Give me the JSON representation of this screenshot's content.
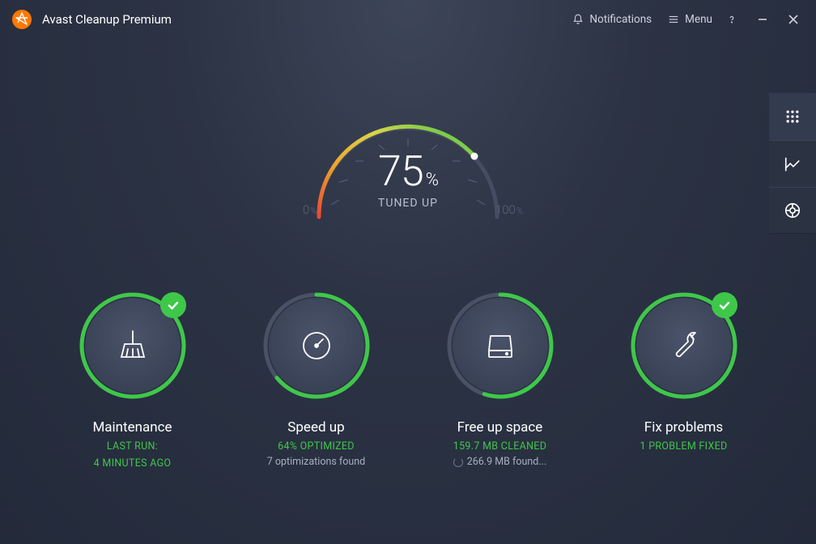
{
  "app": {
    "title": "Avast Cleanup Premium"
  },
  "titlebar": {
    "notifications": "Notifications",
    "menu": "Menu"
  },
  "gauge": {
    "value": "75",
    "percent_sign": "%",
    "label": "TUNED UP",
    "min": "0",
    "max": "100",
    "small_pct": "%"
  },
  "tiles": {
    "maintenance": {
      "title": "Maintenance",
      "status": "LAST RUN:",
      "sub": "4 MINUTES AGO",
      "ring_percent": 100,
      "has_check": true
    },
    "speedup": {
      "title": "Speed up",
      "status": "64% OPTIMIZED",
      "sub": "7 optimizations found",
      "ring_percent": 64,
      "has_check": false
    },
    "freeup": {
      "title": "Free up space",
      "status": "159.7 MB CLEANED",
      "sub": "266.9 MB found...",
      "ring_percent": 55,
      "has_check": false,
      "spinner": true
    },
    "fix": {
      "title": "Fix problems",
      "status": "1 PROBLEM FIXED",
      "sub": "",
      "ring_percent": 100,
      "has_check": true
    }
  },
  "colors": {
    "green": "#3fc74a",
    "ring_bg": "#4a5166"
  }
}
